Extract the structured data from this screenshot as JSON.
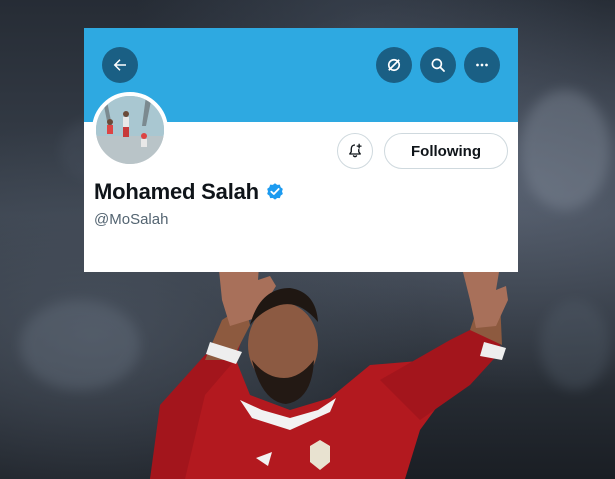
{
  "header": {
    "back_icon": "arrow-left-icon",
    "grok_icon": "slash-circle-icon",
    "search_icon": "search-icon",
    "more_icon": "more-horizontal-icon"
  },
  "profile": {
    "display_name": "Mohamed Salah",
    "handle": "@MoSalah",
    "verified": true,
    "verified_icon": "verified-badge-icon",
    "notify_icon": "bell-plus-icon",
    "following_label": "Following"
  },
  "colors": {
    "banner": "#2ea9e1",
    "header_button": "#1a5f84",
    "verified": "#1d9bf0",
    "handle_text": "#536471",
    "name_text": "#0f1419"
  }
}
